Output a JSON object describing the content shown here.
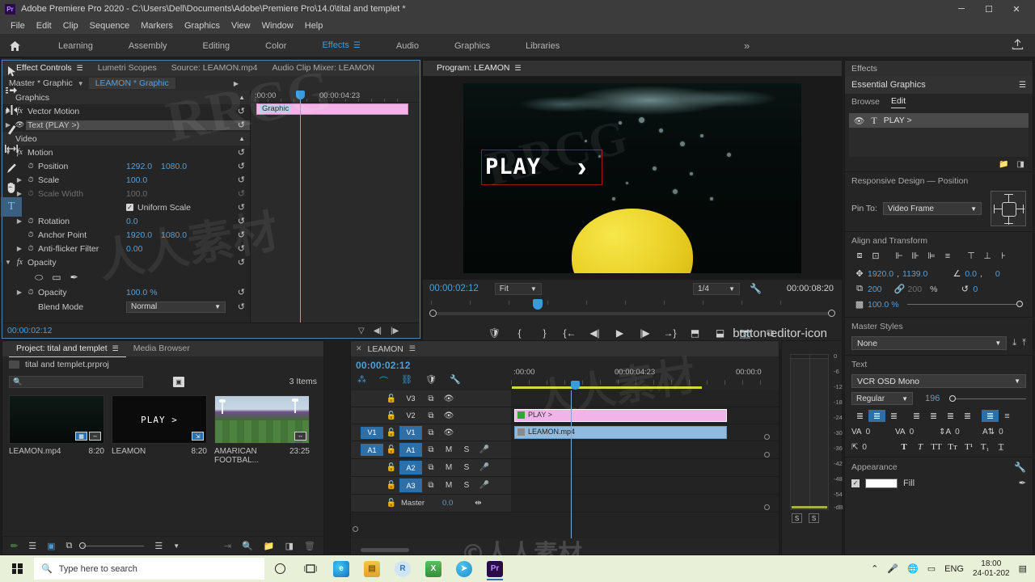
{
  "titlebar": {
    "app_icon": "premiere-logo",
    "title": "Adobe Premiere Pro 2020 - C:\\Users\\Dell\\Documents\\Adobe\\Premiere Pro\\14.0\\tital and templet *",
    "minimize": "─",
    "maximize": "☐",
    "close": "✕"
  },
  "menubar": {
    "items": [
      "File",
      "Edit",
      "Clip",
      "Sequence",
      "Markers",
      "Graphics",
      "View",
      "Window",
      "Help"
    ]
  },
  "workspace": {
    "home_icon": "home-icon",
    "tabs": [
      {
        "label": "Learning",
        "active": false
      },
      {
        "label": "Assembly",
        "active": false
      },
      {
        "label": "Editing",
        "active": false
      },
      {
        "label": "Color",
        "active": false
      },
      {
        "label": "Effects",
        "active": true
      },
      {
        "label": "Audio",
        "active": false
      },
      {
        "label": "Graphics",
        "active": false
      },
      {
        "label": "Libraries",
        "active": false
      }
    ],
    "more": "»",
    "export_icon": "export-icon"
  },
  "effect_controls": {
    "tabs": [
      {
        "label": "Effect Controls",
        "active": true
      },
      {
        "label": "Lumetri Scopes",
        "active": false
      },
      {
        "label": "Source: LEAMON.mp4",
        "active": false
      },
      {
        "label": "Audio Clip Mixer: LEAMON",
        "active": false
      }
    ],
    "master_label": "Master * Graphic",
    "clip_label": "LEAMON * Graphic",
    "rows": [
      {
        "name": "Graphics",
        "type": "group"
      },
      {
        "name": "Vector Motion",
        "type": "fx"
      },
      {
        "name": "Text (PLAY >)",
        "type": "eye",
        "selected": true
      },
      {
        "name": "Video",
        "type": "group"
      },
      {
        "name": "Motion",
        "type": "fx",
        "expanded": true
      },
      {
        "name": "Position",
        "type": "prop",
        "v1": "1292.0",
        "v2": "1080.0"
      },
      {
        "name": "Scale",
        "type": "prop",
        "v1": "100.0"
      },
      {
        "name": "Scale Width",
        "type": "prop",
        "v1": "100.0",
        "disabled": true
      },
      {
        "name": "Uniform Scale",
        "type": "check",
        "checked": true
      },
      {
        "name": "Rotation",
        "type": "prop",
        "v1": "0.0"
      },
      {
        "name": "Anchor Point",
        "type": "prop",
        "v1": "1920.0",
        "v2": "1080.0"
      },
      {
        "name": "Anti-flicker Filter",
        "type": "prop",
        "v1": "0.00"
      },
      {
        "name": "Opacity",
        "type": "fx",
        "expanded": true
      },
      {
        "name": "mask-tools",
        "type": "masks"
      },
      {
        "name": "Opacity",
        "type": "prop",
        "v1": "100.0 %"
      },
      {
        "name": "Blend Mode",
        "type": "select",
        "value": "Normal"
      }
    ],
    "timecode": "00:00:02:12",
    "ruler_labels": [
      ":00:00",
      "00:00:04:23"
    ],
    "clip_bar_label": "Graphic"
  },
  "program": {
    "title": "Program: LEAMON",
    "menu_icon": "hamburger-icon",
    "overlay_text": "PLAY",
    "overlay_chevron": "›",
    "timecode": "00:00:02:12",
    "fit": "Fit",
    "resolution": "1/4",
    "settings_icon": "wrench-icon",
    "duration": "00:00:08:20",
    "tools": [
      "marker-icon",
      "mark-in-icon",
      "mark-out-icon",
      "go-to-in-icon",
      "step-back-icon",
      "play-icon",
      "step-forward-icon",
      "go-to-out-icon",
      "lift-icon",
      "extract-icon",
      "export-frame-icon",
      "comparison-view-icon"
    ],
    "plus_icon": "button-editor-icon"
  },
  "essential_graphics": {
    "effects_tab": "Effects",
    "title": "Essential Graphics",
    "menu_icon": "hamburger-icon",
    "subtabs": [
      {
        "label": "Browse",
        "active": false
      },
      {
        "label": "Edit",
        "active": true
      }
    ],
    "layer": {
      "eye_icon": "eye-icon",
      "type_icon": "text-tool-icon",
      "name": "PLAY >"
    },
    "layer_footer_icons": [
      "new-group-icon",
      "new-layer-icon"
    ],
    "responsive": {
      "heading": "Responsive Design — Position",
      "pin_label": "Pin To:",
      "pin_value": "Video Frame"
    },
    "align": {
      "heading": "Align and Transform",
      "position": {
        "x": "1920.0",
        "y": "1139.0"
      },
      "rotation": "0.0",
      "rotation_deg": "0",
      "scale_x": "200",
      "scale_y": "200",
      "scale_unit": "%",
      "anchor": "0",
      "opacity": "100.0 %"
    },
    "master_styles": {
      "heading": "Master Styles",
      "value": "None"
    },
    "text": {
      "heading": "Text",
      "font": "VCR OSD Mono",
      "style": "Regular",
      "size": "196",
      "kerning": "0",
      "tracking": "0",
      "leading": "0",
      "baseline": "0",
      "shift": "0"
    },
    "appearance": {
      "heading": "Appearance",
      "wrench_icon": "wrench-icon",
      "fill_label": "Fill",
      "fill_checked": true,
      "fill_color": "#ffffff",
      "pen_icon": "eyedropper-icon"
    }
  },
  "project": {
    "tabs": [
      {
        "label": "Project: tital and templet",
        "active": true
      },
      {
        "label": "Media Browser",
        "active": false
      }
    ],
    "file_name": "tital and templet.prproj",
    "search_placeholder": "",
    "search_icon": "search-icon",
    "item_count": "3 Items",
    "items": [
      {
        "name": "LEAMON.mp4",
        "duration": "8:20",
        "kind": "video",
        "selected": false
      },
      {
        "name": "LEAMON",
        "duration": "8:20",
        "kind": "sequence",
        "selected": false,
        "overlay": "PLAY >"
      },
      {
        "name": "AMARICAN FOOTBAL...",
        "duration": "23:25",
        "kind": "video",
        "selected": false
      }
    ],
    "footer_icons": [
      "new-item-pen-icon",
      "list-view-icon",
      "icon-view-icon",
      "freeform-view-icon",
      "zoom-slider",
      "sort-icon",
      "automate-icon",
      "find-icon",
      "new-bin-icon",
      "new-item-icon",
      "delete-icon"
    ]
  },
  "tools": [
    {
      "name": "selection-tool",
      "glyph": "➤",
      "active": false
    },
    {
      "name": "track-select-forward-tool",
      "glyph": "⇥",
      "active": false
    },
    {
      "name": "ripple-edit-tool",
      "glyph": "⬌",
      "active": false
    },
    {
      "name": "razor-tool",
      "glyph": "╱",
      "active": false
    },
    {
      "name": "slip-tool",
      "glyph": "↔",
      "active": false
    },
    {
      "name": "pen-tool",
      "glyph": "✎",
      "active": false
    },
    {
      "name": "hand-tool",
      "glyph": "✋",
      "active": false
    },
    {
      "name": "type-tool",
      "glyph": "T",
      "active": true
    }
  ],
  "timeline": {
    "tab_label": "LEAMON",
    "menu_icon": "hamburger-icon",
    "timecode": "00:00:02:12",
    "header_icons": [
      "insert-overwrite-icon",
      "snap-icon",
      "linked-selection-icon",
      "add-marker-icon",
      "timeline-settings-icon"
    ],
    "ruler_labels": [
      ":00:00",
      "00:00:04:23",
      "00:00:0"
    ],
    "tracks": [
      {
        "name": "V3",
        "target": "",
        "kind": "video",
        "lock": "🔓",
        "sync": true,
        "eye": true
      },
      {
        "name": "V2",
        "target": "",
        "kind": "video",
        "lock": "🔓",
        "sync": true,
        "eye": true,
        "clip": {
          "label": "PLAY >",
          "color": "pink",
          "icon": "graphic-icon"
        }
      },
      {
        "name": "V1",
        "target": "V1",
        "kind": "video",
        "lock": "🔓",
        "sync": true,
        "eye": true,
        "clip": {
          "label": "LEAMON.mp4",
          "color": "blue",
          "icon": "video-icon"
        }
      },
      {
        "name": "A1",
        "target": "A1",
        "kind": "audio",
        "lock": "🔓",
        "m": "M",
        "s": "S",
        "mic": true
      },
      {
        "name": "A2",
        "target": "",
        "kind": "audio",
        "lock": "🔓",
        "m": "M",
        "s": "S",
        "mic": true
      },
      {
        "name": "A3",
        "target": "",
        "kind": "audio",
        "lock": "🔓",
        "m": "M",
        "s": "S",
        "mic": true
      }
    ],
    "master": {
      "label": "Master",
      "value": "0.0",
      "icon": "pan-icon"
    }
  },
  "audio_meters": {
    "scale_labels": [
      "0",
      "-6",
      "-12",
      "-18",
      "-24",
      "-30",
      "-36",
      "-42",
      "-48",
      "-54",
      "-dB"
    ],
    "solo_left": "S",
    "solo_right": "S"
  },
  "taskbar": {
    "start_icon": "windows-start-icon",
    "search_placeholder": "Type here to search",
    "search_icon": "search-icon",
    "apps": [
      {
        "name": "cortana-icon",
        "glyph": "O"
      },
      {
        "name": "task-view-icon",
        "glyph": "⧉"
      },
      {
        "name": "edge-icon",
        "glyph": "e"
      },
      {
        "name": "file-explorer-icon",
        "glyph": "📁"
      },
      {
        "name": "r-app-icon",
        "glyph": "R"
      },
      {
        "name": "excel-icon",
        "glyph": "X"
      },
      {
        "name": "telegram-icon",
        "glyph": "➤"
      },
      {
        "name": "premiere-icon",
        "glyph": "Pr"
      }
    ],
    "tray": [
      "chevron-up-icon",
      "microphone-icon",
      "network-icon",
      "battery-icon"
    ],
    "language": "ENG",
    "time": "18:00",
    "date": "24-01-202",
    "notification_icon": "notifications-icon"
  },
  "watermarks": [
    "RRCG",
    "人人素材"
  ]
}
